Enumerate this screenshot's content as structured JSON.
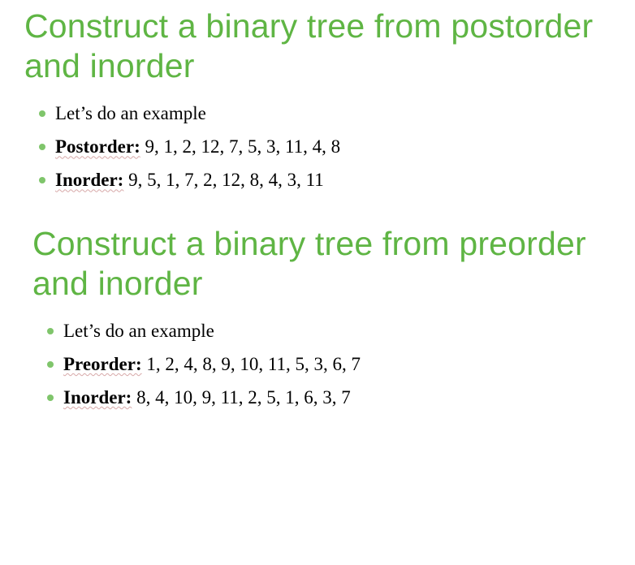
{
  "section1": {
    "title": "Construct a binary tree from postorder and inorder",
    "items": [
      {
        "text": "Let’s do an example"
      },
      {
        "label": "Postorder:",
        "text": " 9, 1, 2, 12, 7, 5, 3, 11, 4, 8"
      },
      {
        "label": "Inorder:",
        "text": " 9, 5, 1, 7, 2, 12, 8, 4, 3, 11"
      }
    ]
  },
  "section2": {
    "title": "Construct a binary tree from preorder and inorder",
    "items": [
      {
        "text": "Let’s do an example"
      },
      {
        "label": "Preorder:",
        "text": " 1, 2, 4, 8, 9, 10, 11, 5, 3, 6, 7"
      },
      {
        "label": "Inorder:",
        "text": " 8, 4, 10, 9, 11, 2, 5, 1, 6, 3, 7"
      }
    ]
  }
}
